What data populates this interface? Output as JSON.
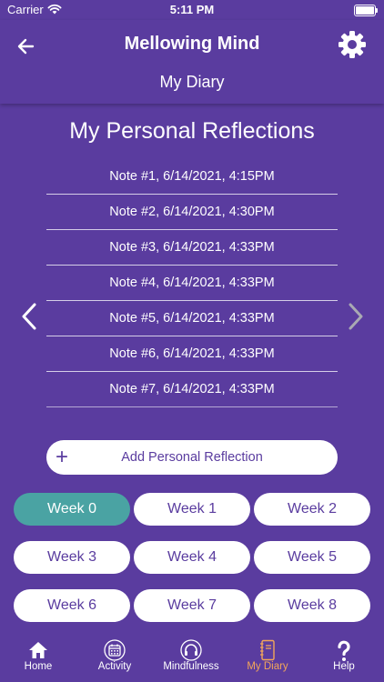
{
  "status": {
    "carrier": "Carrier",
    "time": "5:11 PM"
  },
  "header": {
    "title": "Mellowing Mind",
    "subtitle": "My Diary"
  },
  "section": {
    "title": "My Personal Reflections"
  },
  "notes": [
    "Note #1, 6/14/2021, 4:15PM",
    "Note #2, 6/14/2021, 4:30PM",
    "Note #3, 6/14/2021, 4:33PM",
    "Note #4, 6/14/2021, 4:33PM",
    "Note #5, 6/14/2021, 4:33PM",
    "Note #6, 6/14/2021, 4:33PM",
    "Note #7, 6/14/2021, 4:33PM"
  ],
  "add_button": {
    "icon": "+",
    "label": "Add Personal Reflection"
  },
  "weeks": [
    "Week 0",
    "Week 1",
    "Week 2",
    "Week 3",
    "Week 4",
    "Week 5",
    "Week 6",
    "Week 7",
    "Week 8"
  ],
  "selected_week": "Week 0",
  "tabs": [
    {
      "label": "Home",
      "icon": "home-icon"
    },
    {
      "label": "Activity",
      "icon": "calendar-icon"
    },
    {
      "label": "Mindfulness",
      "icon": "headphones-icon"
    },
    {
      "label": "My Diary",
      "icon": "notebook-icon"
    },
    {
      "label": "Help",
      "icon": "question-mark-icon"
    }
  ],
  "active_tab": "My Diary",
  "colors": {
    "background": "#5a3c9f",
    "selected_week": "#4aa3a3",
    "active_tab": "#f2a65a",
    "inactive_arrow": "#a9a9b3",
    "text": "#ffffff"
  }
}
